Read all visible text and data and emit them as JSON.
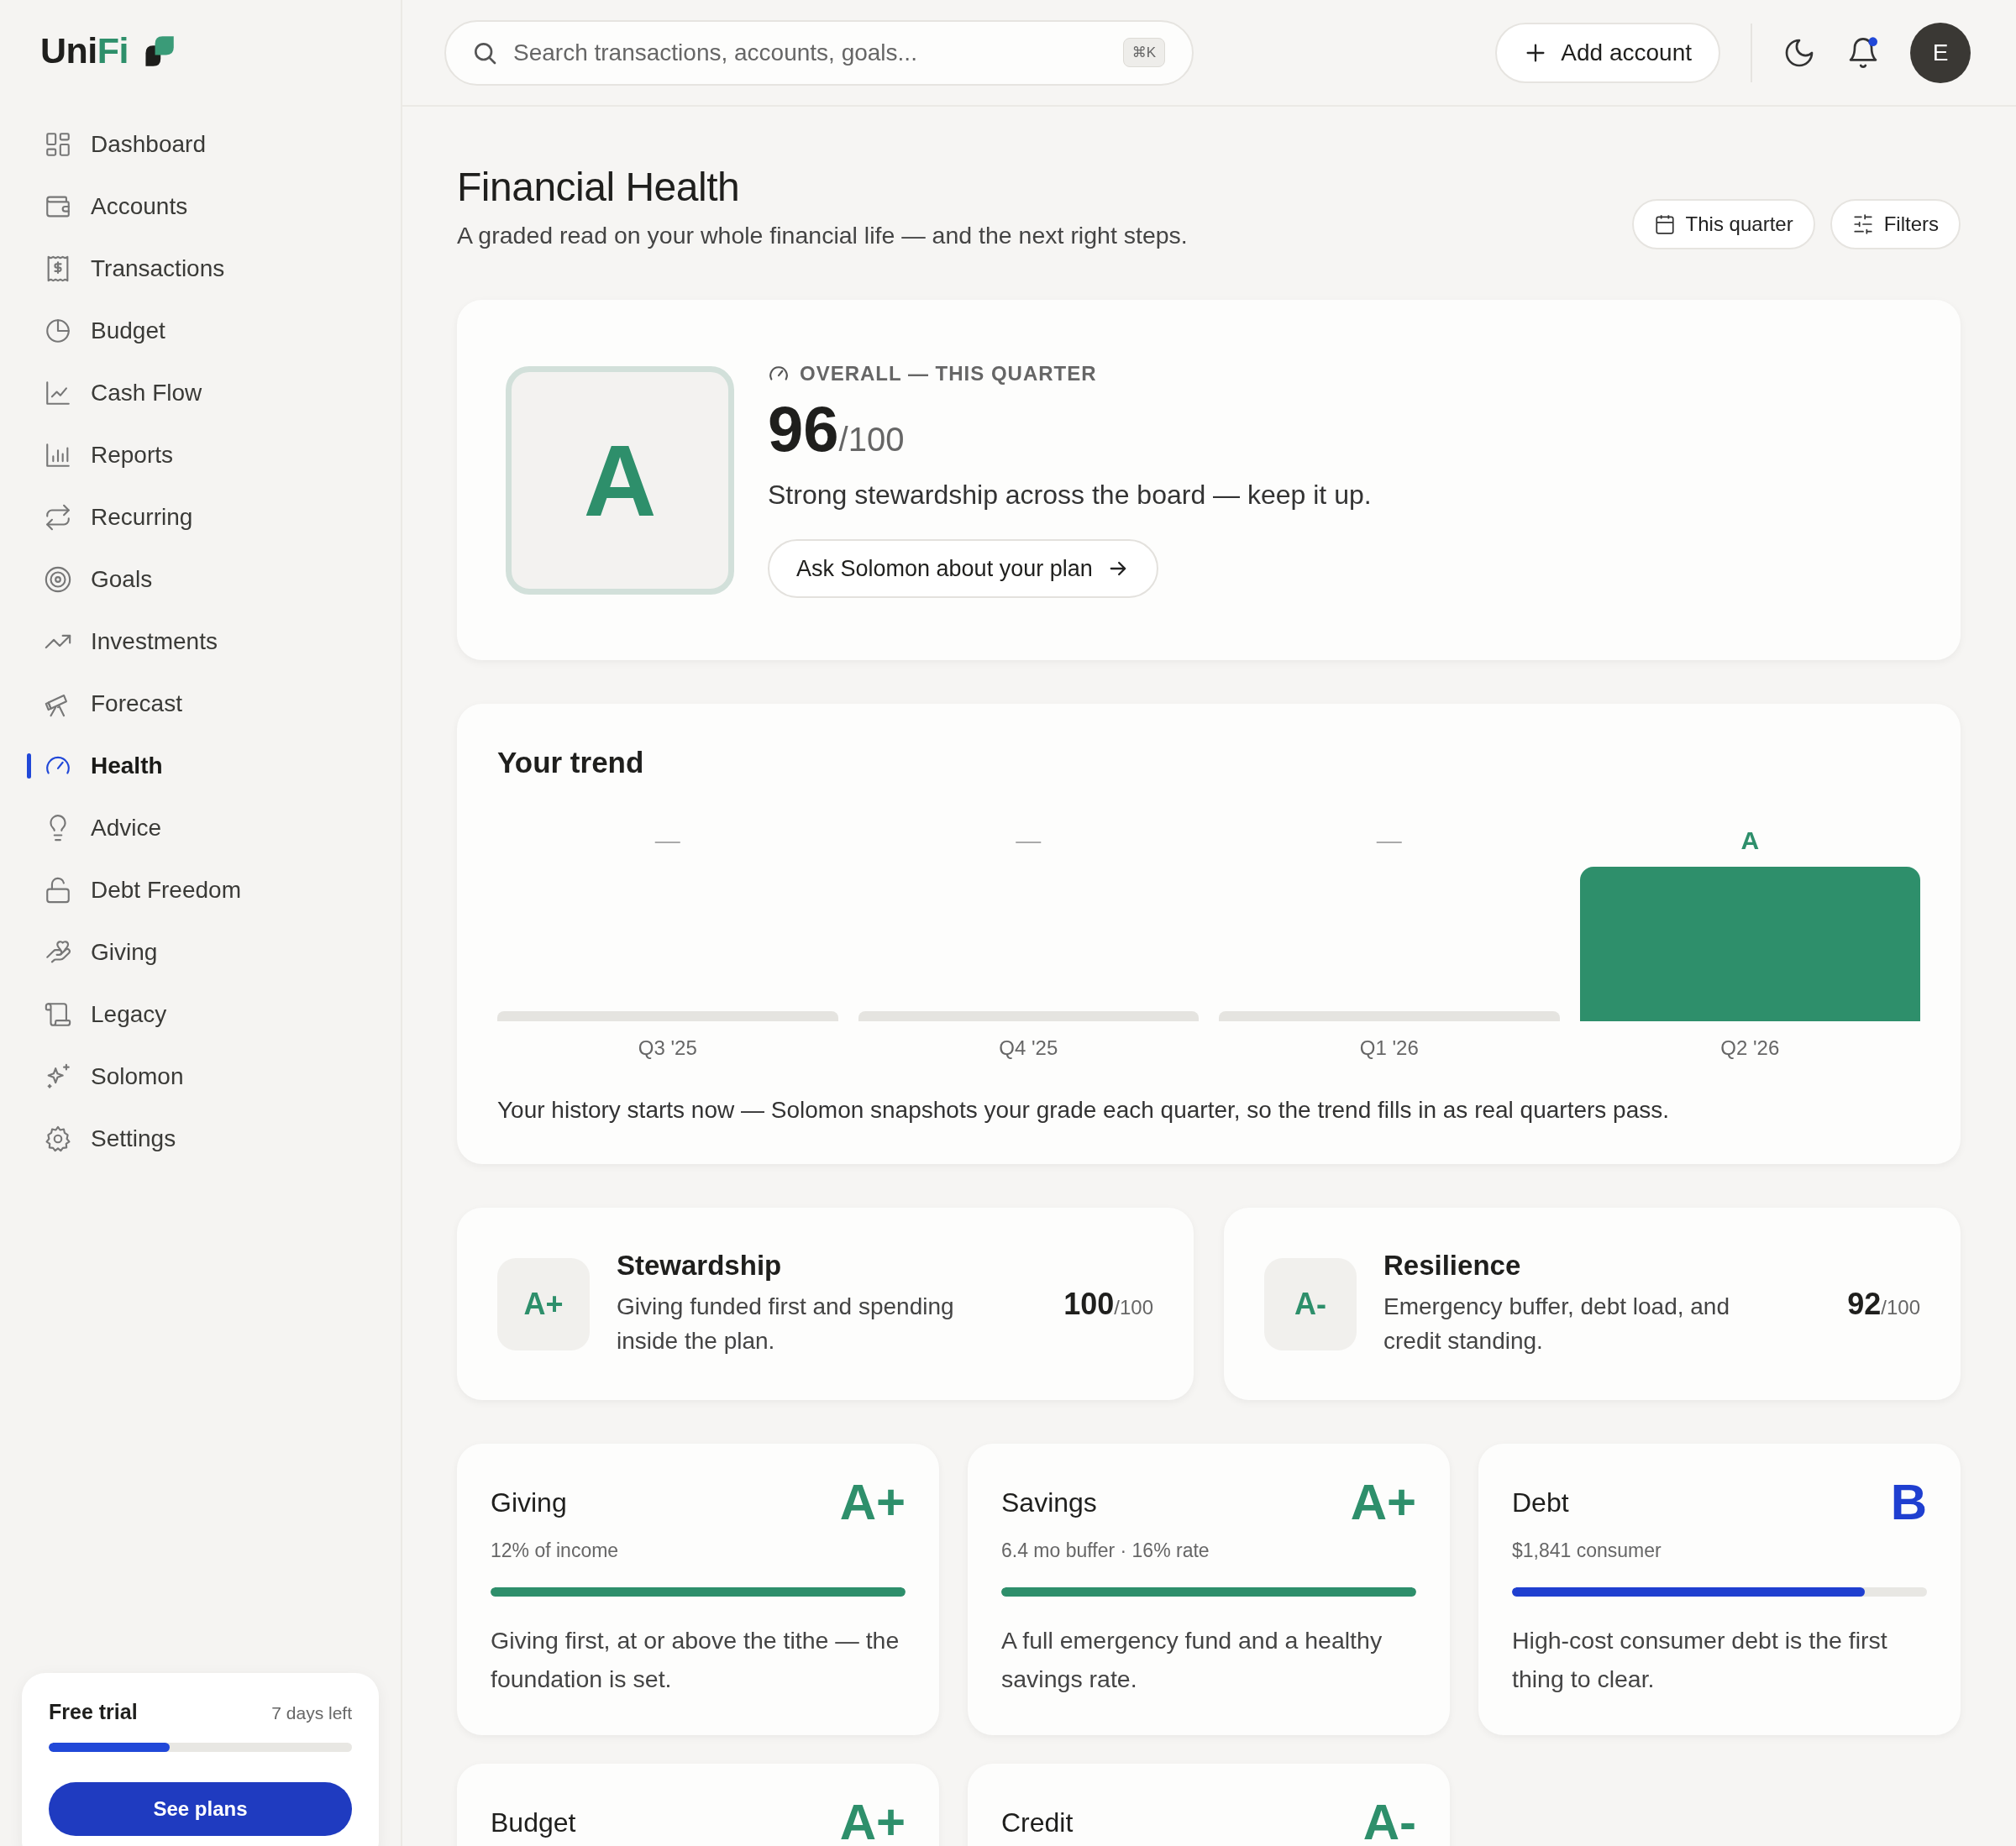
{
  "brand": {
    "name_dark": "Uni",
    "name_accent": "Fi"
  },
  "sidebar": {
    "items": [
      {
        "label": "Dashboard",
        "selected": false
      },
      {
        "label": "Accounts",
        "selected": false
      },
      {
        "label": "Transactions",
        "selected": false
      },
      {
        "label": "Budget",
        "selected": false
      },
      {
        "label": "Cash Flow",
        "selected": false
      },
      {
        "label": "Reports",
        "selected": false
      },
      {
        "label": "Recurring",
        "selected": false
      },
      {
        "label": "Goals",
        "selected": false
      },
      {
        "label": "Investments",
        "selected": false
      },
      {
        "label": "Forecast",
        "selected": false
      },
      {
        "label": "Health",
        "selected": true
      },
      {
        "label": "Advice",
        "selected": false
      },
      {
        "label": "Debt Freedom",
        "selected": false
      },
      {
        "label": "Giving",
        "selected": false
      },
      {
        "label": "Legacy",
        "selected": false
      },
      {
        "label": "Solomon",
        "selected": false
      },
      {
        "label": "Settings",
        "selected": false
      }
    ],
    "trial": {
      "title": "Free trial",
      "remaining": "7 days left",
      "level": 0.4,
      "button": "See plans"
    }
  },
  "header": {
    "search": {
      "placeholder": "Search transactions, accounts, goals...",
      "shortcut": "⌘K"
    },
    "add_button": "Add account",
    "notification_dot": true,
    "avatar": "E"
  },
  "page": {
    "title": "Financial Health",
    "subtitle": "A graded read on your whole financial life — and the next right steps.",
    "period_button": "This quarter",
    "filters_button": "Filters"
  },
  "overall": {
    "grade": "A",
    "label": "OVERALL — THIS QUARTER",
    "score": "96",
    "out_of": "/100",
    "message": "Strong stewardship across the board — keep it up.",
    "button": "Ask Solomon about your plan"
  },
  "trend": {
    "title": "Your trend",
    "quarters": [
      {
        "label": "Q3 '25",
        "grade": "—",
        "recorded": false
      },
      {
        "label": "Q4 '25",
        "grade": "—",
        "recorded": false
      },
      {
        "label": "Q1 '26",
        "grade": "—",
        "recorded": false
      },
      {
        "label": "Q2 '26",
        "grade": "A",
        "recorded": true
      }
    ],
    "note": "Your history starts now — Solomon snapshots your grade each quarter, so the trend fills in as real quarters pass."
  },
  "pillars": [
    {
      "grade": "A+",
      "title": "Stewardship",
      "description": "Giving funded first and spending inside the plan.",
      "score": "100",
      "out_of": "/100"
    },
    {
      "grade": "A-",
      "title": "Resilience",
      "description": "Emergency buffer, debt load, and credit standing.",
      "score": "92",
      "out_of": "/100"
    }
  ],
  "categories": [
    {
      "title": "Giving",
      "grade": "A+",
      "color": "#2e8f6b",
      "detail": "12% of income",
      "level": 1,
      "description": "Giving first, at or above the tithe — the foundation is set."
    },
    {
      "title": "Savings",
      "grade": "A+",
      "color": "#2e8f6b",
      "detail": "6.4 mo buffer · 16% rate",
      "level": 1,
      "description": "A full emergency fund and a healthy savings rate."
    },
    {
      "title": "Debt",
      "grade": "B",
      "color": "#1f3fd0",
      "detail": "$1,841 consumer",
      "level": 0.85,
      "description": "High-cost consumer debt is the first thing to clear."
    },
    {
      "title": "Budget",
      "grade": "A+",
      "color": "#2e8f6b"
    },
    {
      "title": "Credit",
      "grade": "A-",
      "color": "#2e8f6b"
    }
  ]
}
